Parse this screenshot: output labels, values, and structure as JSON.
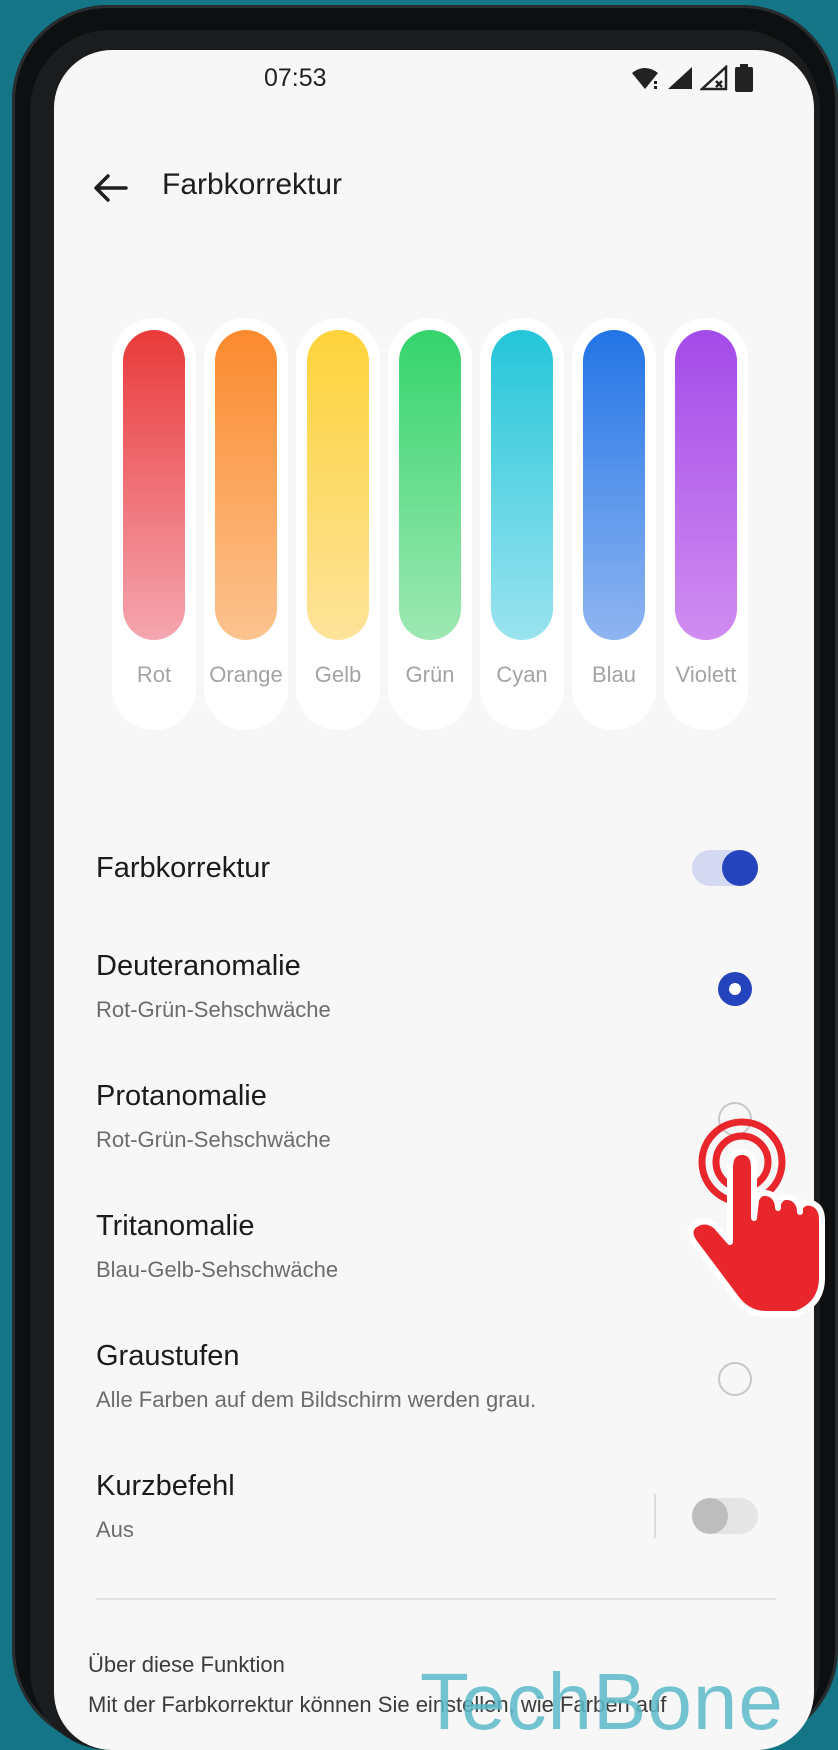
{
  "status_bar": {
    "time": "07:53",
    "icons": [
      "wifi-icon",
      "signal-icon",
      "signal-no-sim-icon",
      "battery-icon"
    ]
  },
  "header": {
    "title": "Farbkorrektur",
    "back_icon": "arrow-left-icon"
  },
  "swatches": [
    {
      "label": "Rot",
      "top": "#e93a3a",
      "bottom": "#f5a6b0"
    },
    {
      "label": "Orange",
      "top": "#fb8a2e",
      "bottom": "#fcc38f"
    },
    {
      "label": "Gelb",
      "top": "#fdd33a",
      "bottom": "#fde39a"
    },
    {
      "label": "Grün",
      "top": "#34d46c",
      "bottom": "#9ee8b3"
    },
    {
      "label": "Cyan",
      "top": "#24c6d9",
      "bottom": "#9ae3ef"
    },
    {
      "label": "Blau",
      "top": "#2274e6",
      "bottom": "#8fb5f1"
    },
    {
      "label": "Violett",
      "top": "#a44be9",
      "bottom": "#d08cf0"
    }
  ],
  "settings": {
    "correction": {
      "title": "Farbkorrektur",
      "enabled": true
    },
    "options": [
      {
        "title": "Deuteranomalie",
        "subtitle": "Rot-Grün-Sehschwäche",
        "selected": true
      },
      {
        "title": "Protanomalie",
        "subtitle": "Rot-Grün-Sehschwäche",
        "selected": false
      },
      {
        "title": "Tritanomalie",
        "subtitle": "Blau-Gelb-Sehschwäche",
        "selected": false
      },
      {
        "title": "Graustufen",
        "subtitle": "Alle Farben auf dem Bildschirm werden grau.",
        "selected": false
      }
    ],
    "shortcut": {
      "title": "Kurzbefehl",
      "subtitle": "Aus",
      "enabled": false
    }
  },
  "about": {
    "heading": "Über diese Funktion",
    "text": "Mit der Farbkorrektur können Sie einstellen, wie Farben auf"
  },
  "watermark": "TechBone",
  "colors": {
    "accent": "#2443bd",
    "background": "#137585",
    "tap_hand": "#e8262b"
  }
}
